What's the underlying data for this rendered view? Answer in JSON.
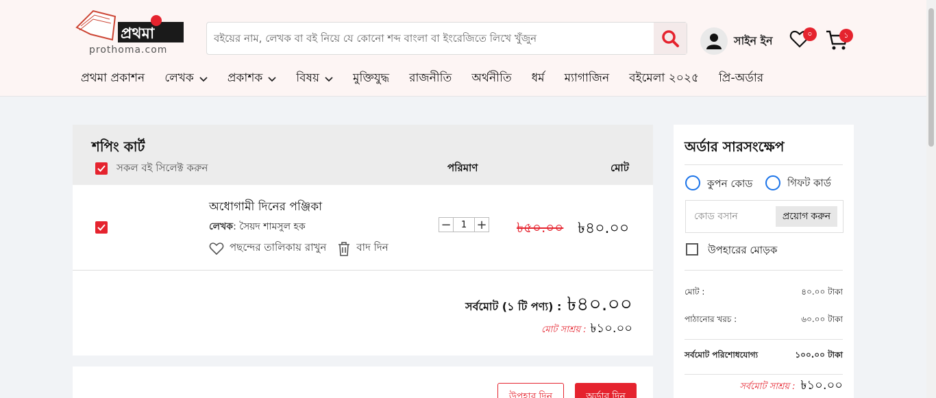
{
  "header": {
    "logo_text": "প্রথমা",
    "logo_sub": "prothoma.com",
    "search_placeholder": "বইয়ের নাম, লেখক বা বই নিয়ে যে কোনো শব্দ বাংলা বা ইংরেজিতে লিখে খুঁজুন",
    "signin": "সাইন ইন",
    "wishlist_count": "০",
    "cart_count": "১"
  },
  "nav": [
    {
      "label": "প্রথমা প্রকাশন",
      "dropdown": false
    },
    {
      "label": "লেখক",
      "dropdown": true
    },
    {
      "label": "প্রকাশক",
      "dropdown": true
    },
    {
      "label": "বিষয়",
      "dropdown": true
    },
    {
      "label": "মুক্তিযুদ্ধ",
      "dropdown": false
    },
    {
      "label": "রাজনীতি",
      "dropdown": false
    },
    {
      "label": "অর্থনীতি",
      "dropdown": false
    },
    {
      "label": "ধর্ম",
      "dropdown": false
    },
    {
      "label": "ম্যাগাজিন",
      "dropdown": false
    },
    {
      "label": "বইমেলা ২০২৫",
      "dropdown": false
    },
    {
      "label": "প্রি-অর্ডার",
      "dropdown": false
    }
  ],
  "cart": {
    "title": "শপিং কার্ট",
    "select_all": "সকল বই সিলেক্ট করুন",
    "col_quantity": "পরিমাণ",
    "col_total": "মোট",
    "item": {
      "title": "অধোগামী দিনের পঞ্জিকা",
      "author_label": "লেখক",
      "author": ": সৈয়দ শামসুল হক",
      "wishlist_action": "পছন্দের তালিকায় রাখুন",
      "remove_action": "বাদ দিন",
      "quantity": "1",
      "old_price": "৳৫০.০০",
      "new_price": "৳৪০.০০"
    },
    "grand_label": "সর্বমোট (১ টি পণ্য) :",
    "grand_value": "৳৪০.০০",
    "save_label": "মোট সাশ্রয় :",
    "save_value": "৳১০.০০",
    "gift_button": "উপহার দিন",
    "order_button": "অর্ডার দিন"
  },
  "summary": {
    "title": "অর্ডার সারসংক্ষেপ",
    "coupon_label": "কুপন কোড",
    "giftcard_label": "গিফট কার্ড",
    "code_placeholder": "কোড বসান",
    "apply_button": "প্রয়োগ করুন",
    "gift_wrap_label": "উপহারের মোড়ক",
    "rows": [
      {
        "label": "মোট :",
        "value": "৪০.০০ টাকা"
      },
      {
        "label": "পাঠানোর খরচ :",
        "value": "৬০.০০ টাকা"
      },
      {
        "label": "সর্বমোট পরিশোধযোগ্য",
        "value": "১০০.০০ টাকা"
      }
    ],
    "save_label": "সর্বমোট সাশ্রয় :",
    "save_value": "৳১০.০০"
  },
  "colors": {
    "accent": "#e5232e",
    "radio": "#1a73e8"
  }
}
